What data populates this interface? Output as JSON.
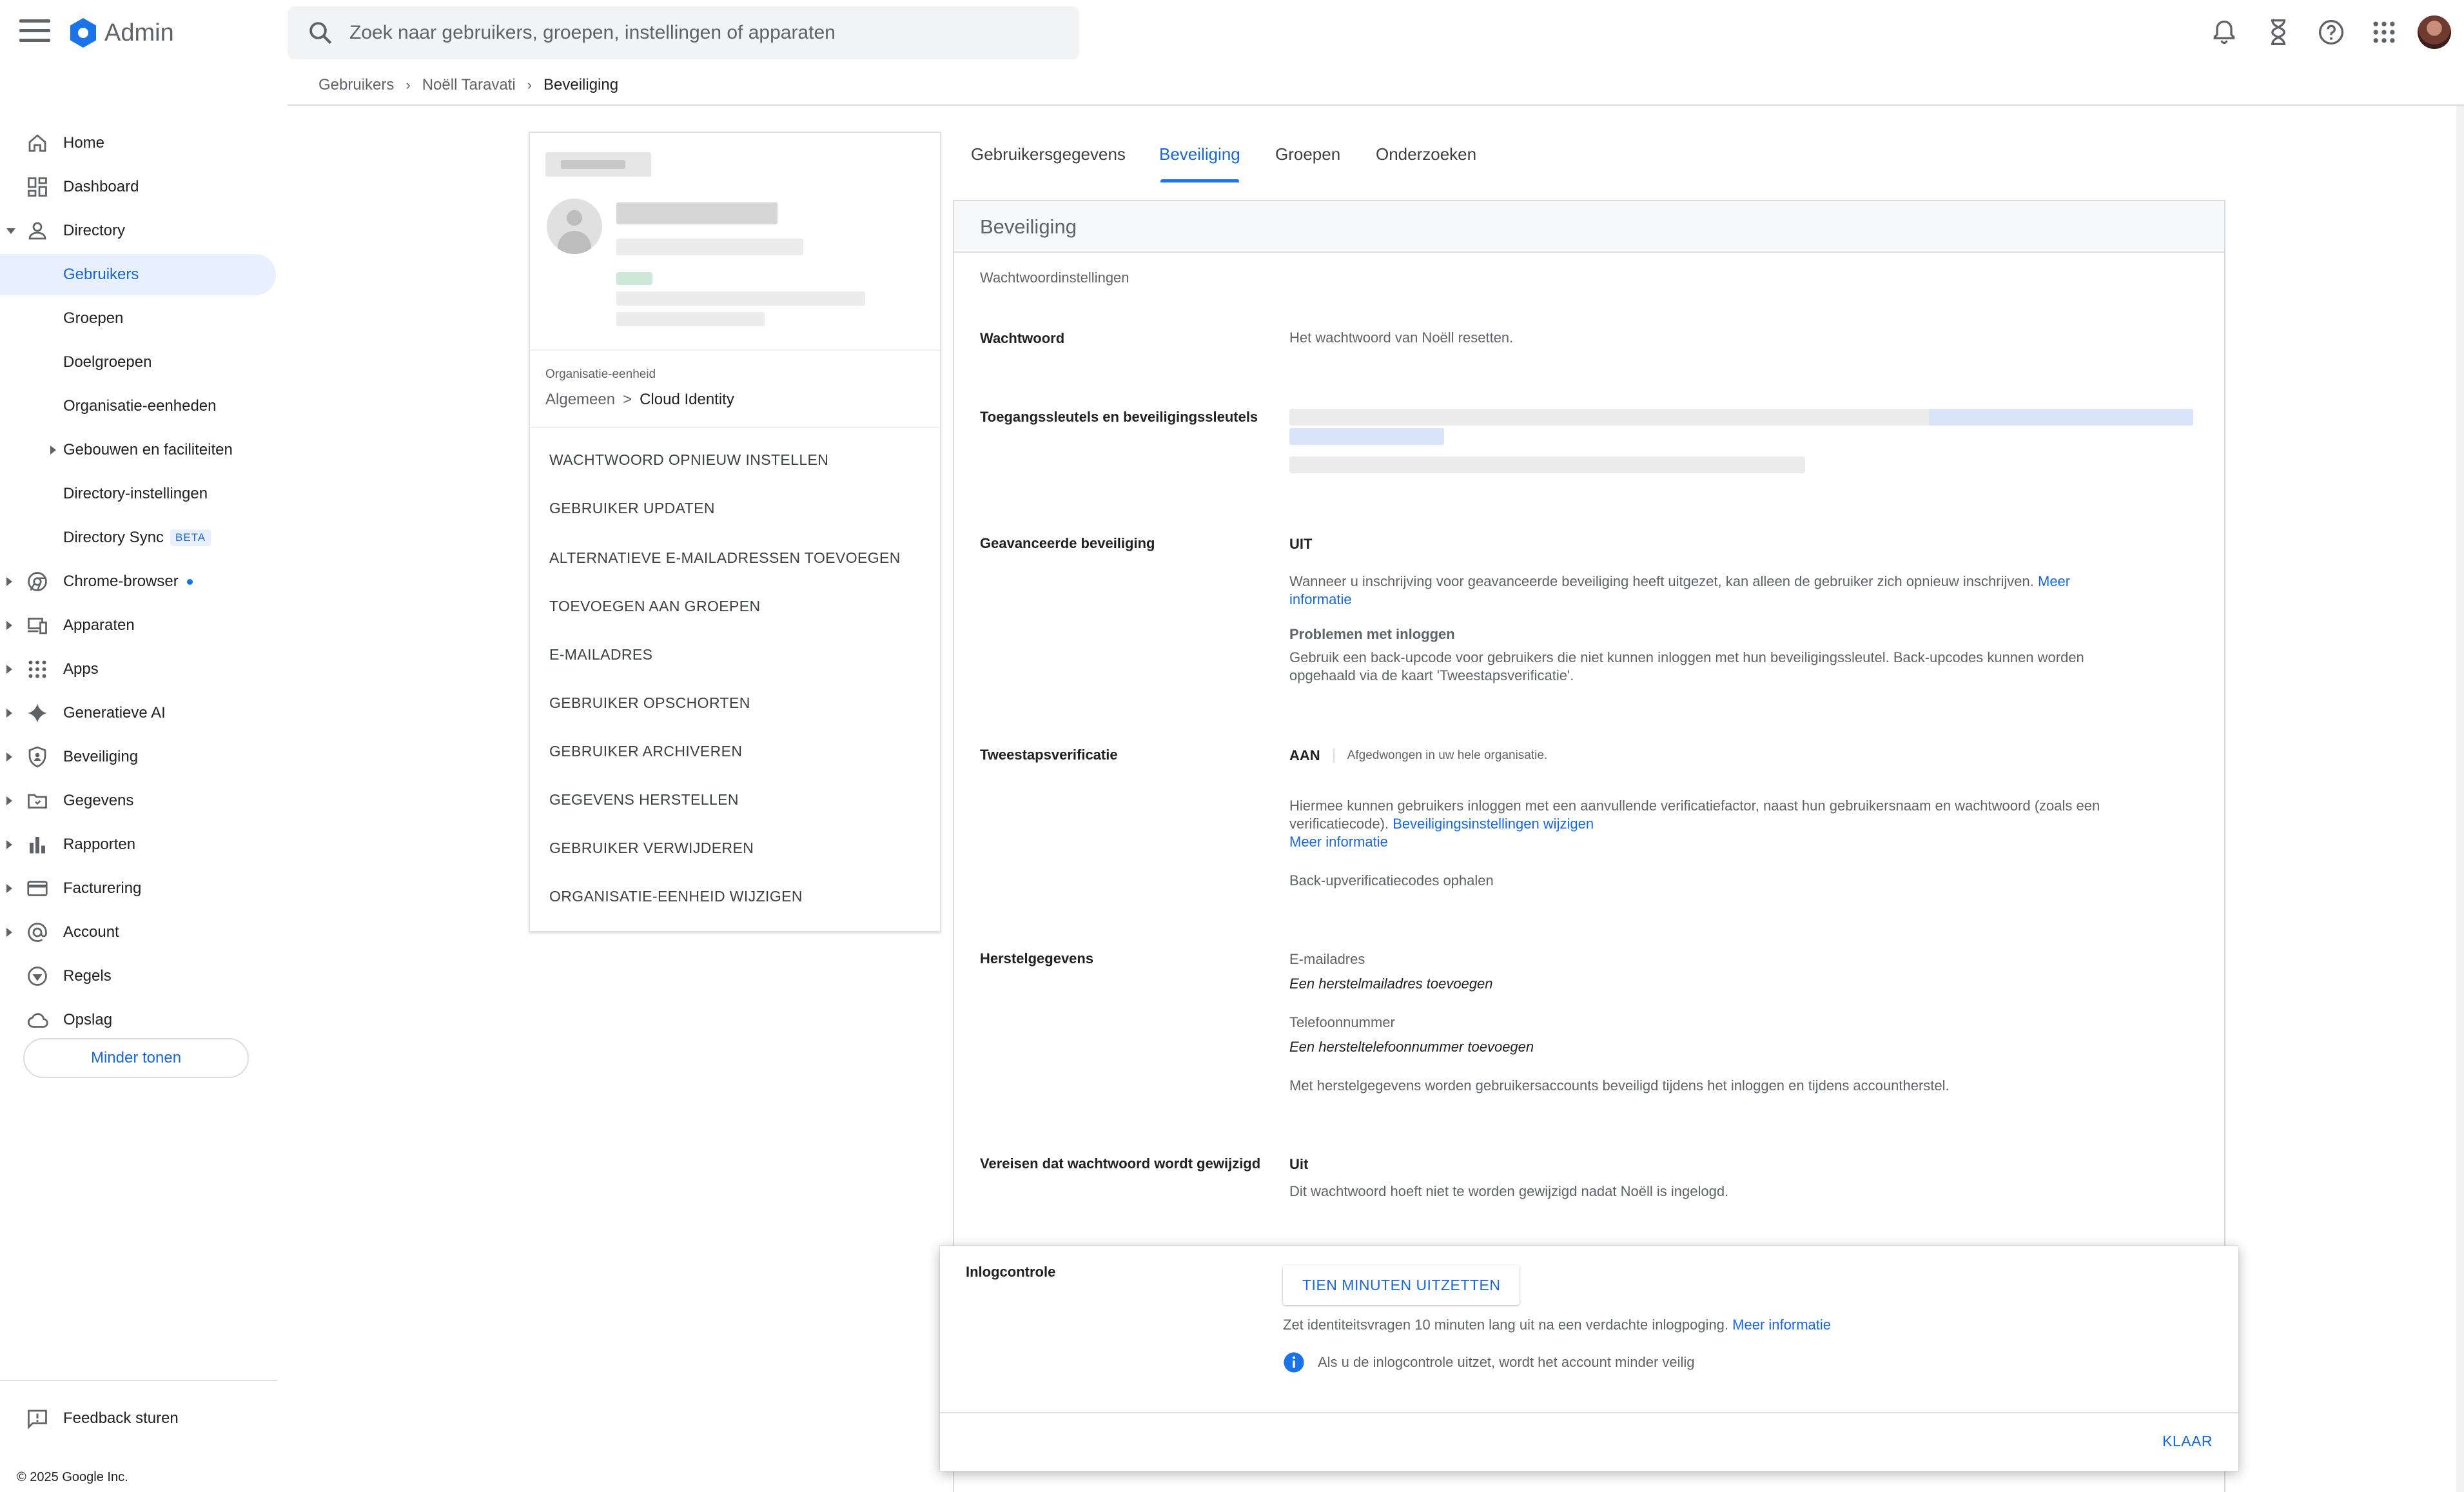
{
  "header": {
    "app_title": "Admin",
    "search_placeholder": "Zoek naar gebruikers, groepen, instellingen of apparaten"
  },
  "breadcrumb": [
    "Gebruikers",
    "Noëll Taravati",
    "Beveiliging"
  ],
  "sidebar": {
    "items": [
      {
        "label": "Home",
        "icon": "home-icon"
      },
      {
        "label": "Dashboard",
        "icon": "dashboard-icon"
      },
      {
        "label": "Directory",
        "icon": "person-icon"
      },
      {
        "label": "Gebruikers"
      },
      {
        "label": "Groepen"
      },
      {
        "label": "Doelgroepen"
      },
      {
        "label": "Organisatie-eenheden"
      },
      {
        "label": "Gebouwen en faciliteiten"
      },
      {
        "label": "Directory-instellingen"
      },
      {
        "label": "Directory Sync",
        "badge": "BETA"
      },
      {
        "label": "Chrome-browser",
        "icon": "chrome-icon"
      },
      {
        "label": "Apparaten",
        "icon": "devices-icon"
      },
      {
        "label": "Apps",
        "icon": "apps-grid-icon"
      },
      {
        "label": "Generatieve AI",
        "icon": "sparkle-icon"
      },
      {
        "label": "Beveiliging",
        "icon": "shield-icon"
      },
      {
        "label": "Gegevens",
        "icon": "folder-icon"
      },
      {
        "label": "Rapporten",
        "icon": "bar-chart-icon"
      },
      {
        "label": "Facturering",
        "icon": "credit-card-icon"
      },
      {
        "label": "Account",
        "icon": "at-sign-icon"
      },
      {
        "label": "Regels",
        "icon": "rules-icon"
      },
      {
        "label": "Opslag",
        "icon": "cloud-icon"
      }
    ],
    "show_less": "Minder tonen",
    "feedback": "Feedback sturen",
    "copyright": "© 2025 Google Inc."
  },
  "user_card": {
    "org_unit_label": "Organisatie-eenheid",
    "org_path": [
      "Algemeen",
      "Cloud Identity"
    ],
    "actions": [
      "WACHTWOORD OPNIEUW INSTELLEN",
      "GEBRUIKER UPDATEN",
      "ALTERNATIEVE E-MAILADRESSEN TOEVOEGEN",
      "TOEVOEGEN AAN GROEPEN",
      "E-MAILADRES",
      "GEBRUIKER OPSCHORTEN",
      "GEBRUIKER ARCHIVEREN",
      "GEGEVENS HERSTELLEN",
      "GEBRUIKER VERWIJDEREN",
      "ORGANISATIE-EENHEID WIJZIGEN"
    ]
  },
  "tabs": [
    "Gebruikersgegevens",
    "Beveiliging",
    "Groepen",
    "Onderzoeken"
  ],
  "security": {
    "title": "Beveiliging",
    "password_settings": "Wachtwoordinstellingen",
    "password_label": "Wachtwoord",
    "password_text": "Het wachtwoord van Noëll resetten.",
    "passkeys_label": "Toegangssleutels en beveiligingssleutels",
    "advanced_label": "Geavanceerde beveiliging",
    "advanced_status": "UIT",
    "advanced_desc": "Wanneer u inschrijving voor geavanceerde beveiliging heeft uitgezet, kan alleen de gebruiker zich opnieuw inschrijven.",
    "advanced_more_1": "Meer",
    "advanced_more_2": "informatie",
    "login_problems_title": "Problemen met inloggen",
    "login_problems_text_1": "Gebruik een back-upcode voor gebruikers die niet kunnen inloggen met hun beveiligingssleutel. Back-upcodes kunnen worden",
    "login_problems_text_2": "opgehaald via de kaart 'Tweestapsverificatie'.",
    "twostep_label": "Tweestapsverificatie",
    "twostep_status": "AAN",
    "twostep_enforced": "Afgedwongen in uw hele organisatie.",
    "twostep_desc_1": "Hiermee kunnen gebruikers inloggen met een aanvullende verificatiefactor, naast hun gebruikersnaam en wachtwoord (zoals een",
    "twostep_desc_2": "verificatiecode).",
    "twostep_settings_link": "Beveiligingsinstellingen wijzigen",
    "twostep_more": "Meer informatie",
    "backup_codes": "Back-upverificatiecodes ophalen",
    "recovery_label": "Herstelgegevens",
    "recovery_email_label": "E-mailadres",
    "recovery_email_value": "Een herstelmailadres toevoegen",
    "recovery_phone_label": "Telefoonnummer",
    "recovery_phone_value": "Een hersteltelefoonnummer toevoegen",
    "recovery_desc": "Met herstelgegevens worden gebruikersaccounts beveiligd tijdens het inloggen en tijdens accountherstel.",
    "change_pw_label": "Vereisen dat wachtwoord wordt gewijzigd",
    "change_pw_status": "Uit",
    "change_pw_desc": "Dit wachtwoord hoeft niet te worden gewijzigd nadat Noëll is ingelogd."
  },
  "login_challenge": {
    "label": "Inlogcontrole",
    "button": "TIEN MINUTEN UITZETTEN",
    "desc": "Zet identiteitsvragen 10 minuten lang uit na een verdachte inlogpoging.",
    "more": "Meer informatie",
    "warning": "Als u de inlogcontrole uitzet, wordt het account minder veilig",
    "done": "KLAAR"
  },
  "colors": {
    "accent": "#1a73e8",
    "link": "#1967d2",
    "active_nav_bg": "#e8f0fe"
  }
}
